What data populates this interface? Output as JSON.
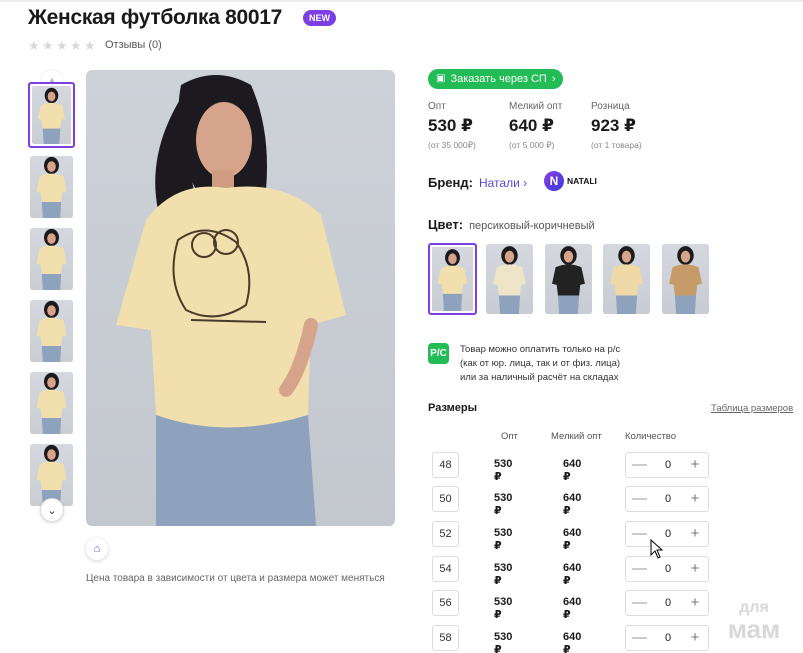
{
  "product": {
    "title": "Женская футболка 80017",
    "badge": "NEW",
    "reviews": "Отзывы (0)",
    "rating_stars": 0,
    "price_note": "Цена товара в зависимости от цвета и размера может меняться"
  },
  "order_sp": {
    "label": "Заказать через СП",
    "chevron": "›"
  },
  "prices": [
    {
      "label": "Опт",
      "value": "530 ₽",
      "sub": "(от 35 000₽)"
    },
    {
      "label": "Мелкий опт",
      "value": "640 ₽",
      "sub": "(от 5 000 ₽)"
    },
    {
      "label": "Розница",
      "value": "923 ₽",
      "sub": "(от 1 товара)"
    }
  ],
  "brand": {
    "label": "Бренд:",
    "name": "Натали",
    "chevron": "›",
    "logo_letter": "N",
    "logo_text": "NATALI"
  },
  "color": {
    "label": "Цвет:",
    "value": "персиковый-коричневый"
  },
  "swatches": [
    {
      "name": "peach",
      "shirt": "#f1dfae",
      "active": true
    },
    {
      "name": "light",
      "shirt": "#eee4c8",
      "active": false
    },
    {
      "name": "black",
      "shirt": "#222222",
      "active": false
    },
    {
      "name": "peach-2",
      "shirt": "#efd9a6",
      "active": false
    },
    {
      "name": "brown",
      "shirt": "#c79a6a",
      "active": false
    }
  ],
  "payment_note": {
    "icon": "Р/С",
    "lines": [
      "Товар можно оплатить только на р/с",
      "(как от юр. лица, так и от физ. лица)",
      "или за наличный расчёт на складах"
    ]
  },
  "sizes": {
    "title": "Размеры",
    "table_link": "Таблица размеров",
    "headers": {
      "opt": "Опт",
      "small_opt": "Мелкий опт",
      "qty": "Количество"
    },
    "rows": [
      {
        "size": "48",
        "opt": "530 ₽",
        "small_opt": "640 ₽",
        "qty": "0"
      },
      {
        "size": "50",
        "opt": "530 ₽",
        "small_opt": "640 ₽",
        "qty": "0"
      },
      {
        "size": "52",
        "opt": "530 ₽",
        "small_opt": "640 ₽",
        "qty": "0"
      },
      {
        "size": "54",
        "opt": "530 ₽",
        "small_opt": "640 ₽",
        "qty": "0"
      },
      {
        "size": "56",
        "opt": "530 ₽",
        "small_opt": "640 ₽",
        "qty": "0"
      },
      {
        "size": "58",
        "opt": "530 ₽",
        "small_opt": "640 ₽",
        "qty": "0"
      }
    ],
    "minus": "—",
    "plus": "+"
  },
  "watermark": {
    "line1": "для",
    "line2": "мам"
  },
  "icons": {
    "star": "star-icon",
    "chevron_up": "chevron-up-icon",
    "chevron_down": "chevron-down-icon",
    "hanger": "hanger-icon",
    "cart": "cart-icon",
    "cursor": "mouse-cursor-icon"
  },
  "colors": {
    "accent": "#7b3fe4",
    "green": "#22bb55",
    "brand_link": "#5a48d8"
  }
}
